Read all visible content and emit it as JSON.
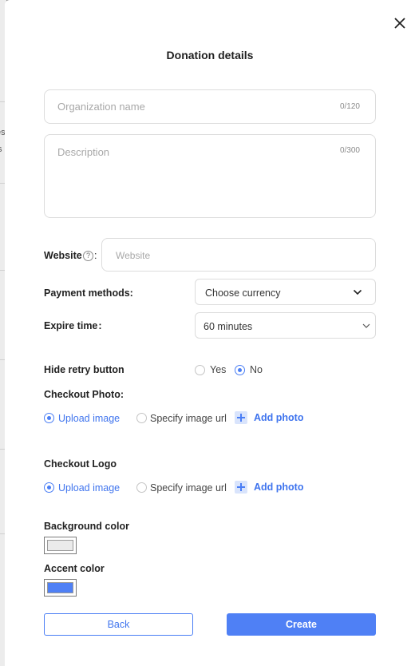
{
  "background": {
    "fragments": [
      "es",
      "s"
    ]
  },
  "modal": {
    "title": "Donation details",
    "close_icon": "close-icon"
  },
  "form": {
    "organization": {
      "placeholder": "Organization name",
      "counter": "0/120",
      "value": ""
    },
    "description": {
      "placeholder": "Description",
      "counter": "0/300",
      "value": ""
    },
    "website": {
      "label": "Website",
      "colon": ":",
      "placeholder": "Website",
      "value": "",
      "help_icon": "question-circle-icon"
    },
    "payment_methods": {
      "label": "Payment methods:",
      "value": "Choose currency",
      "icon": "chevron-down-icon"
    },
    "expire_time": {
      "label": "Expire time :",
      "value": "60 minutes",
      "icon": "chevron-down-icon"
    },
    "hide_retry": {
      "label": "Hide retry button",
      "options": [
        "Yes",
        "No"
      ],
      "selected": "No"
    },
    "checkout_photo": {
      "label": "Checkout Photo:",
      "options": [
        "Upload image",
        "Specify image url"
      ],
      "selected": "Upload image",
      "add_label": "Add photo"
    },
    "checkout_logo": {
      "label": "Checkout Logo",
      "options": [
        "Upload image",
        "Specify image url"
      ],
      "selected": "Upload image",
      "add_label": "Add photo"
    },
    "background_color": {
      "label": "Background color",
      "color": "#ebebeb"
    },
    "accent_color": {
      "label": "Accent color",
      "color": "#4f80f5"
    }
  },
  "actions": {
    "back": "Back",
    "create": "Create"
  },
  "colors": {
    "accent": "#4f80f5",
    "border": "#dcdcdc"
  }
}
